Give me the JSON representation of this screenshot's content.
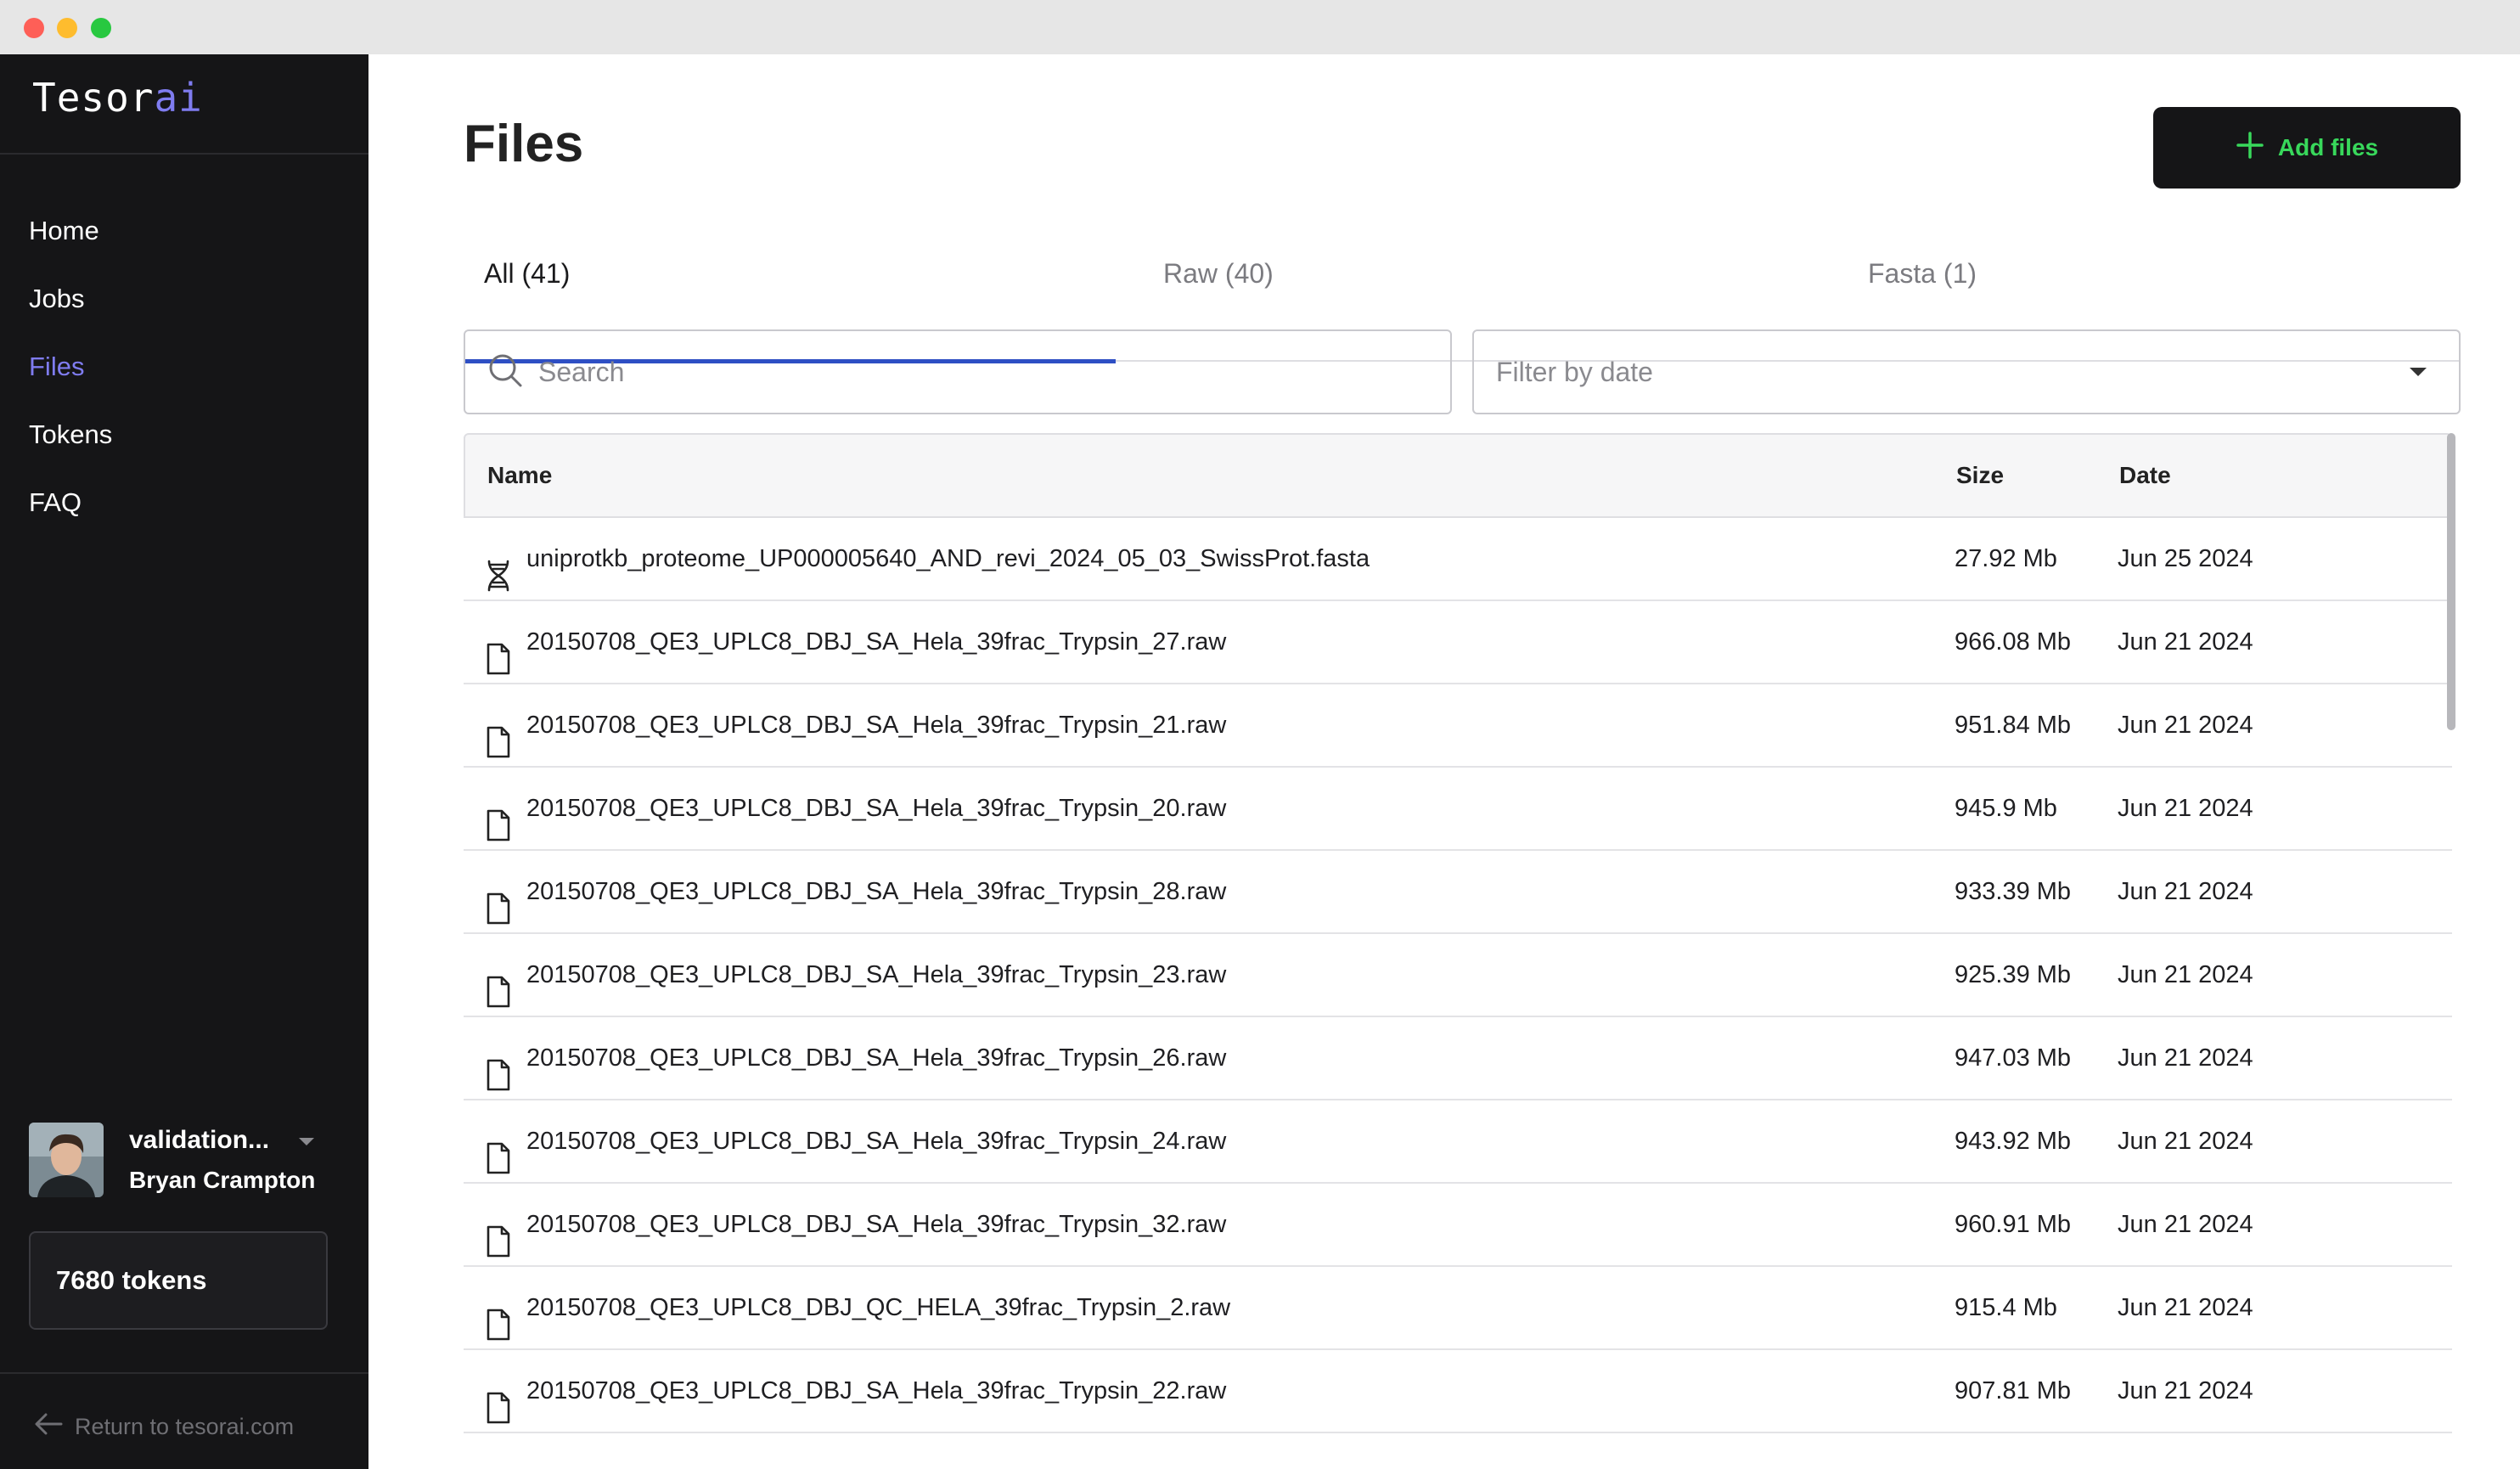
{
  "sidebar": {
    "logo_prefix": "Tesor",
    "logo_suffix": "ai",
    "nav": [
      {
        "label": "Home",
        "active": false
      },
      {
        "label": "Jobs",
        "active": false
      },
      {
        "label": "Files",
        "active": true
      },
      {
        "label": "Tokens",
        "active": false
      },
      {
        "label": "FAQ",
        "active": false
      }
    ],
    "user": {
      "handle": "validation...",
      "name": "Bryan Crampton"
    },
    "tokens_label": "7680 tokens",
    "return_link": "Return to tesorai.com"
  },
  "main": {
    "title": "Files",
    "add_button": "Add files",
    "tabs": [
      {
        "label": "All (41)",
        "active": true
      },
      {
        "label": "Raw (40)",
        "active": false
      },
      {
        "label": "Fasta (1)",
        "active": false
      }
    ],
    "search_placeholder": "Search",
    "filter_placeholder": "Filter by date",
    "table": {
      "headers": {
        "name": "Name",
        "size": "Size",
        "date": "Date"
      },
      "rows": [
        {
          "icon": "dna-icon",
          "name": "uniprotkb_proteome_UP000005640_AND_revi_2024_05_03_SwissProt.fasta",
          "size": "27.92 Mb",
          "date": "Jun 25 2024"
        },
        {
          "icon": "file-icon",
          "name": "20150708_QE3_UPLC8_DBJ_SA_Hela_39frac_Trypsin_27.raw",
          "size": "966.08 Mb",
          "date": "Jun 21 2024"
        },
        {
          "icon": "file-icon",
          "name": "20150708_QE3_UPLC8_DBJ_SA_Hela_39frac_Trypsin_21.raw",
          "size": "951.84 Mb",
          "date": "Jun 21 2024"
        },
        {
          "icon": "file-icon",
          "name": "20150708_QE3_UPLC8_DBJ_SA_Hela_39frac_Trypsin_20.raw",
          "size": "945.9 Mb",
          "date": "Jun 21 2024"
        },
        {
          "icon": "file-icon",
          "name": "20150708_QE3_UPLC8_DBJ_SA_Hela_39frac_Trypsin_28.raw",
          "size": "933.39 Mb",
          "date": "Jun 21 2024"
        },
        {
          "icon": "file-icon",
          "name": "20150708_QE3_UPLC8_DBJ_SA_Hela_39frac_Trypsin_23.raw",
          "size": "925.39 Mb",
          "date": "Jun 21 2024"
        },
        {
          "icon": "file-icon",
          "name": "20150708_QE3_UPLC8_DBJ_SA_Hela_39frac_Trypsin_26.raw",
          "size": "947.03 Mb",
          "date": "Jun 21 2024"
        },
        {
          "icon": "file-icon",
          "name": "20150708_QE3_UPLC8_DBJ_SA_Hela_39frac_Trypsin_24.raw",
          "size": "943.92 Mb",
          "date": "Jun 21 2024"
        },
        {
          "icon": "file-icon",
          "name": "20150708_QE3_UPLC8_DBJ_SA_Hela_39frac_Trypsin_32.raw",
          "size": "960.91 Mb",
          "date": "Jun 21 2024"
        },
        {
          "icon": "file-icon",
          "name": "20150708_QE3_UPLC8_DBJ_QC_HELA_39frac_Trypsin_2.raw",
          "size": "915.4 Mb",
          "date": "Jun 21 2024"
        },
        {
          "icon": "file-icon",
          "name": "20150708_QE3_UPLC8_DBJ_SA_Hela_39frac_Trypsin_22.raw",
          "size": "907.81 Mb",
          "date": "Jun 21 2024"
        }
      ]
    }
  },
  "colors": {
    "accent": "#7f7cf0",
    "add_button_text": "#38d85b",
    "tab_underline": "#2e4fc4"
  }
}
